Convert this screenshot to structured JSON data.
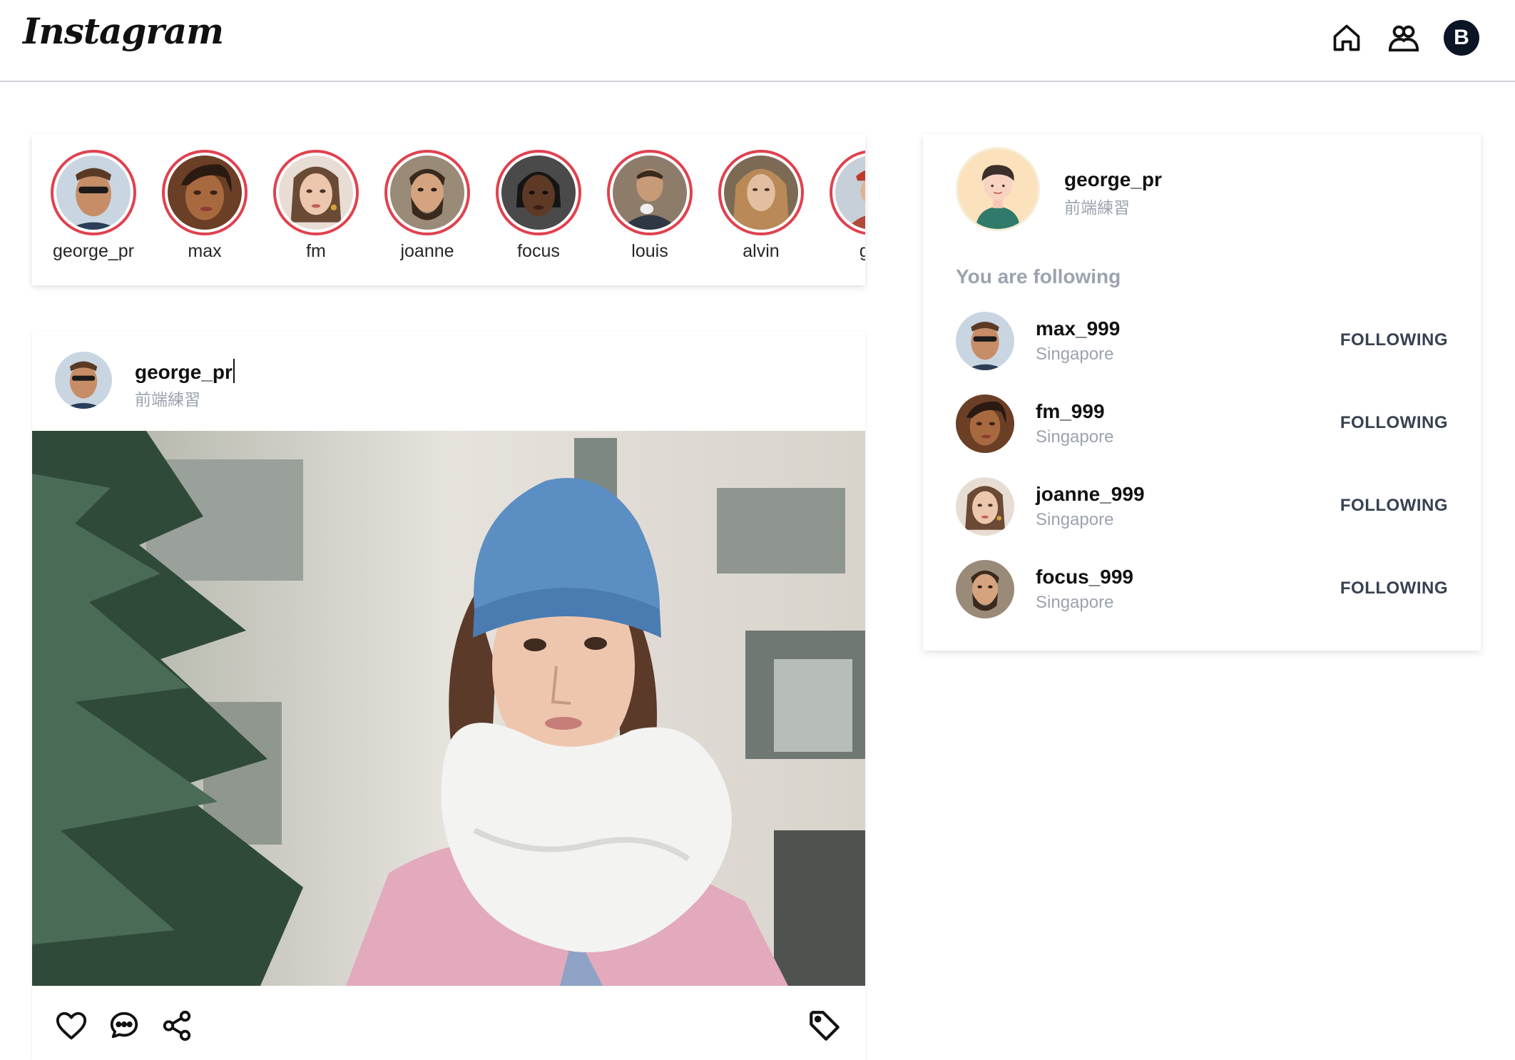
{
  "app": {
    "logo": "Instagram"
  },
  "header": {
    "icons": [
      "home-icon",
      "users-icon"
    ],
    "user_initial": "B"
  },
  "stories": [
    {
      "name": "george_pr",
      "color": "#b98a6a"
    },
    {
      "name": "max",
      "color": "#8a5a3c"
    },
    {
      "name": "fm",
      "color": "#d9b59c"
    },
    {
      "name": "joanne",
      "color": "#5a4030"
    },
    {
      "name": "focus",
      "color": "#3b2a22"
    },
    {
      "name": "louis",
      "color": "#6f5c4c"
    },
    {
      "name": "alvin",
      "color": "#b89a7a"
    },
    {
      "name": "gra",
      "color": "#a7b6c8"
    }
  ],
  "post": {
    "username": "george_pr",
    "subtitle": "前端練習",
    "actions": [
      "heart-icon",
      "comment-icon",
      "share-icon"
    ],
    "save_icon": "tag-icon"
  },
  "profile": {
    "username": "george_pr",
    "subtitle": "前端練習"
  },
  "following": {
    "title": "You are following",
    "users": [
      {
        "name": "max_999",
        "location": "Singapore",
        "button": "FOLLOWING",
        "color": "#b98a6a"
      },
      {
        "name": "fm_999",
        "location": "Singapore",
        "button": "FOLLOWING",
        "color": "#8a5a3c"
      },
      {
        "name": "joanne_999",
        "location": "Singapore",
        "button": "FOLLOWING",
        "color": "#d9b59c"
      },
      {
        "name": "focus_999",
        "location": "Singapore",
        "button": "FOLLOWING",
        "color": "#5a4030"
      }
    ]
  },
  "colors": {
    "story_ring": "#e0414f",
    "muted": "#9ca3af",
    "dark": "#0b1526"
  }
}
